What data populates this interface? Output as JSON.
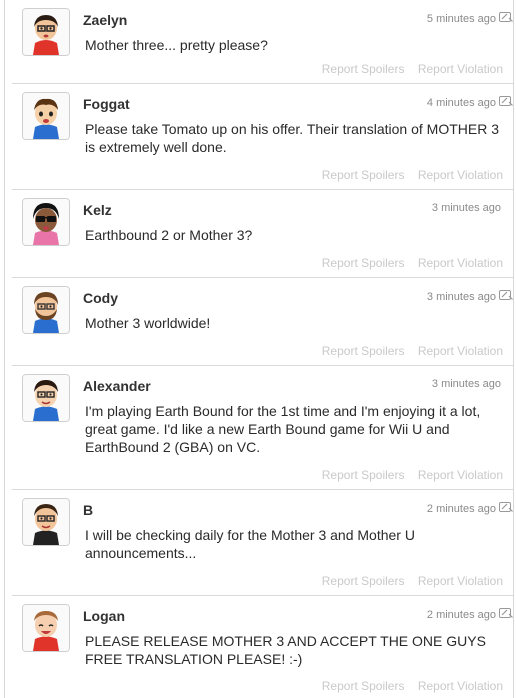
{
  "posts": [
    {
      "name": "Zaelyn",
      "time": "5 minutes ago",
      "spoiler_icon": true,
      "body": "Mother three... pretty please?",
      "avatar": "mii-avatar-zaelyn"
    },
    {
      "name": "Foggat",
      "time": "4 minutes ago",
      "spoiler_icon": true,
      "body": "Please take Tomato up on his offer. Their translation of MOTHER 3 is extremely well done.",
      "avatar": "mii-avatar-foggat"
    },
    {
      "name": "Kelz",
      "time": "3 minutes ago",
      "spoiler_icon": false,
      "body": "Earthbound 2 or Mother 3?",
      "avatar": "mii-avatar-kelz"
    },
    {
      "name": "Cody",
      "time": "3 minutes ago",
      "spoiler_icon": true,
      "body": "Mother 3 worldwide!",
      "avatar": "mii-avatar-cody"
    },
    {
      "name": "Alexander",
      "time": "3 minutes ago",
      "spoiler_icon": false,
      "body": "I'm playing Earth Bound for the 1st time and I'm enjoying it a lot, great game. I'd like a new Earth Bound game for Wii U and EarthBound 2 (GBA) on VC.",
      "avatar": "mii-avatar-alexander"
    },
    {
      "name": "B",
      "time": "2 minutes ago",
      "spoiler_icon": true,
      "body": "I will be checking daily for the Mother 3 and Mother U announcements...",
      "avatar": "mii-avatar-b"
    },
    {
      "name": "Logan",
      "time": "2 minutes ago",
      "spoiler_icon": true,
      "body": "PLEASE RELEASE MOTHER 3 AND ACCEPT THE ONE GUYS FREE TRANSLATION PLEASE! :-)",
      "avatar": "mii-avatar-logan"
    }
  ],
  "actions": {
    "report_spoilers": "Report Spoilers",
    "report_violation": "Report Violation"
  },
  "colors": {
    "action_text": "#c9c9c9",
    "time_text": "#8a8a8a",
    "divider": "#d9d9d9"
  }
}
